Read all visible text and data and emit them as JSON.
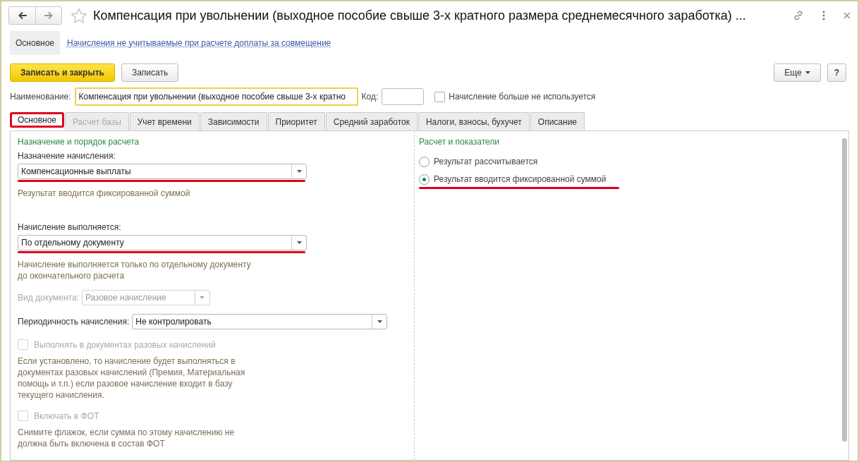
{
  "window": {
    "title": "Компенсация при увольнении (выходное пособие свыше 3-х кратного размера среднемесячного заработка) ..."
  },
  "nav": [
    {
      "label": "Основное",
      "selected": true
    },
    {
      "label": "Начисления не учитываемые при расчете доплаты за совмещение",
      "selected": false
    }
  ],
  "toolbar": {
    "save_close": "Записать и закрыть",
    "save": "Записать",
    "more": "Еще",
    "help": "?"
  },
  "name_field": {
    "label": "Наименование:",
    "value": "Компенсация при увольнении (выходное пособие свыше 3-х кратно"
  },
  "code_field": {
    "label": "Код:"
  },
  "unused_checkbox": {
    "label": "Начисление больше не используется",
    "checked": false
  },
  "tabs": [
    {
      "label": "Основное",
      "selected": true,
      "disabled": false,
      "highlighted": true
    },
    {
      "label": "Расчет базы",
      "selected": false,
      "disabled": true,
      "highlighted": false
    },
    {
      "label": "Учет времени",
      "selected": false,
      "disabled": false,
      "highlighted": false
    },
    {
      "label": "Зависимости",
      "selected": false,
      "disabled": false,
      "highlighted": false
    },
    {
      "label": "Приоритет",
      "selected": false,
      "disabled": false,
      "highlighted": false
    },
    {
      "label": "Средний заработок",
      "selected": false,
      "disabled": false,
      "highlighted": false
    },
    {
      "label": "Налоги, взносы, бухучет",
      "selected": false,
      "disabled": false,
      "highlighted": false
    },
    {
      "label": "Описание",
      "selected": false,
      "disabled": false,
      "highlighted": false
    }
  ],
  "left_column": {
    "title": "Назначение и порядок расчета",
    "items": [
      {
        "kind": "select",
        "label": "Назначение начисления:",
        "value": "Компенсационные выплаты",
        "underlined": true,
        "disabled": false
      },
      {
        "kind": "note",
        "text": "Результат вводится фиксированной суммой"
      },
      {
        "kind": "select",
        "label": "Начисление выполняется:",
        "value": "По отдельному документу",
        "underlined": true,
        "disabled": false
      },
      {
        "kind": "note",
        "text": "Начисление выполняется только по отдельному документу до окончательного расчета"
      },
      {
        "kind": "inline_select",
        "label": "Вид документа:",
        "value": "Разовое начисление",
        "disabled": true,
        "wide": false
      },
      {
        "kind": "inline_select",
        "label": "Периодичность начисления:",
        "value": "Не контролировать",
        "disabled": false,
        "wide": true
      },
      {
        "kind": "checkbox",
        "label": "Выполнять в документах разовых начислений",
        "checked": false,
        "disabled": true
      },
      {
        "kind": "note",
        "text": "Если установлено, то начисление будет выполняться в документах разовых начислений (Премия, Материальная помощь и т.п.) если разовое начисление входит в базу текущего начисления."
      },
      {
        "kind": "checkbox",
        "label": "Включать в ФОТ",
        "checked": false,
        "disabled": true
      },
      {
        "kind": "note",
        "text": "Снимите флажок, если сумма по этому начислению не должна быть включена в состав ФОТ"
      }
    ]
  },
  "right_column": {
    "title": "Расчет и показатели",
    "radios": [
      {
        "label": "Результат рассчитывается",
        "selected": false,
        "underlined": false
      },
      {
        "label": "Результат вводится фиксированной суммой",
        "selected": true,
        "underlined": true
      }
    ]
  }
}
